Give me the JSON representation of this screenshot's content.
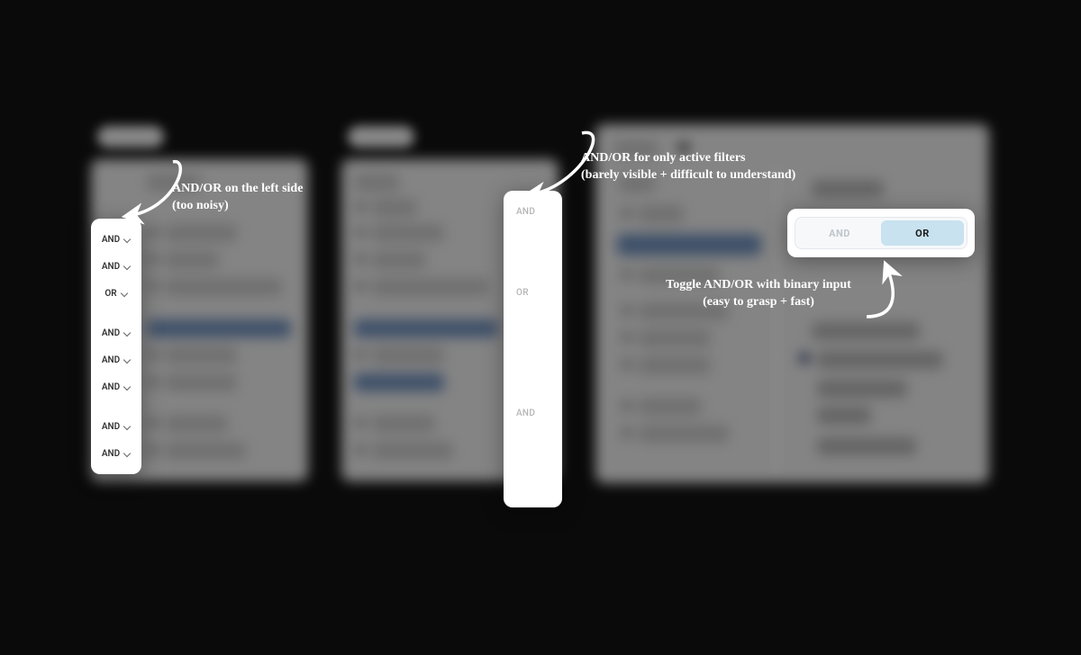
{
  "annotations": {
    "left_line1": "AND/OR on the left side",
    "left_line2": "(too noisy)",
    "mid_line1": "AND/OR for only active filters",
    "mid_line2": "(barely visible + difficult to understand)",
    "right_line1": "Toggle AND/OR with binary input",
    "right_line2": "(easy to grasp + fast)"
  },
  "dropdown_stack": {
    "rows": [
      "AND",
      "AND",
      "OR",
      "AND",
      "AND",
      "AND",
      "AND",
      "AND"
    ]
  },
  "gutter_stack": {
    "rows": [
      "AND",
      "",
      "",
      "OR",
      "",
      "",
      "",
      "AND",
      "",
      ""
    ]
  },
  "toggle": {
    "left": "AND",
    "right": "OR",
    "active": "right"
  }
}
